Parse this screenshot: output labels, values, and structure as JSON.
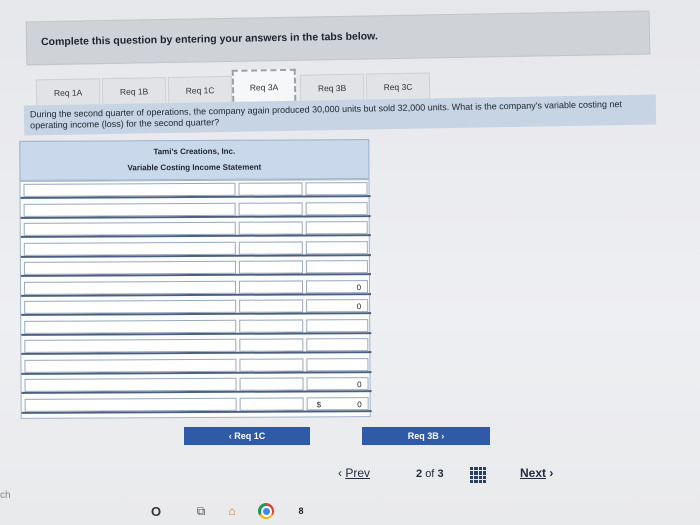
{
  "instruction": "Complete this question by entering your answers in the tabs below.",
  "tabs": [
    {
      "label": "Req 1A"
    },
    {
      "label": "Req 1B"
    },
    {
      "label": "Req 1C"
    },
    {
      "label": "Req 3A"
    },
    {
      "label": "Req 3B"
    },
    {
      "label": "Req 3C"
    }
  ],
  "active_tab": "Req 3A",
  "question": "During the second quarter of operations, the company again produced 30,000 units but sold 32,000 units. What is the company's variable costing net operating income (loss) for the second quarter?",
  "statement": {
    "company": "Tami's Creations, Inc.",
    "title": "Variable Costing Income Statement",
    "rows": [
      {
        "col3": ""
      },
      {
        "col3": ""
      },
      {
        "col3": ""
      },
      {
        "col3": ""
      },
      {
        "col3": ""
      },
      {
        "col3": "0"
      },
      {
        "col3": "0"
      },
      {
        "col3": ""
      },
      {
        "col3": ""
      },
      {
        "col3": ""
      },
      {
        "col3": "0"
      },
      {
        "col3": "0",
        "currency": "$"
      }
    ]
  },
  "buttons": {
    "prev_req": "Req 1C",
    "next_req": "Req 3B"
  },
  "pager": {
    "prev": "Prev",
    "current": "2",
    "of": "of",
    "total": "3",
    "next": "Next"
  },
  "taskbar": {
    "edge_text": "ch",
    "icons": [
      "cortana-circle-icon",
      "task-view-icon",
      "store-icon",
      "chrome-icon",
      "app-badge-icon"
    ],
    "badge": "8"
  }
}
